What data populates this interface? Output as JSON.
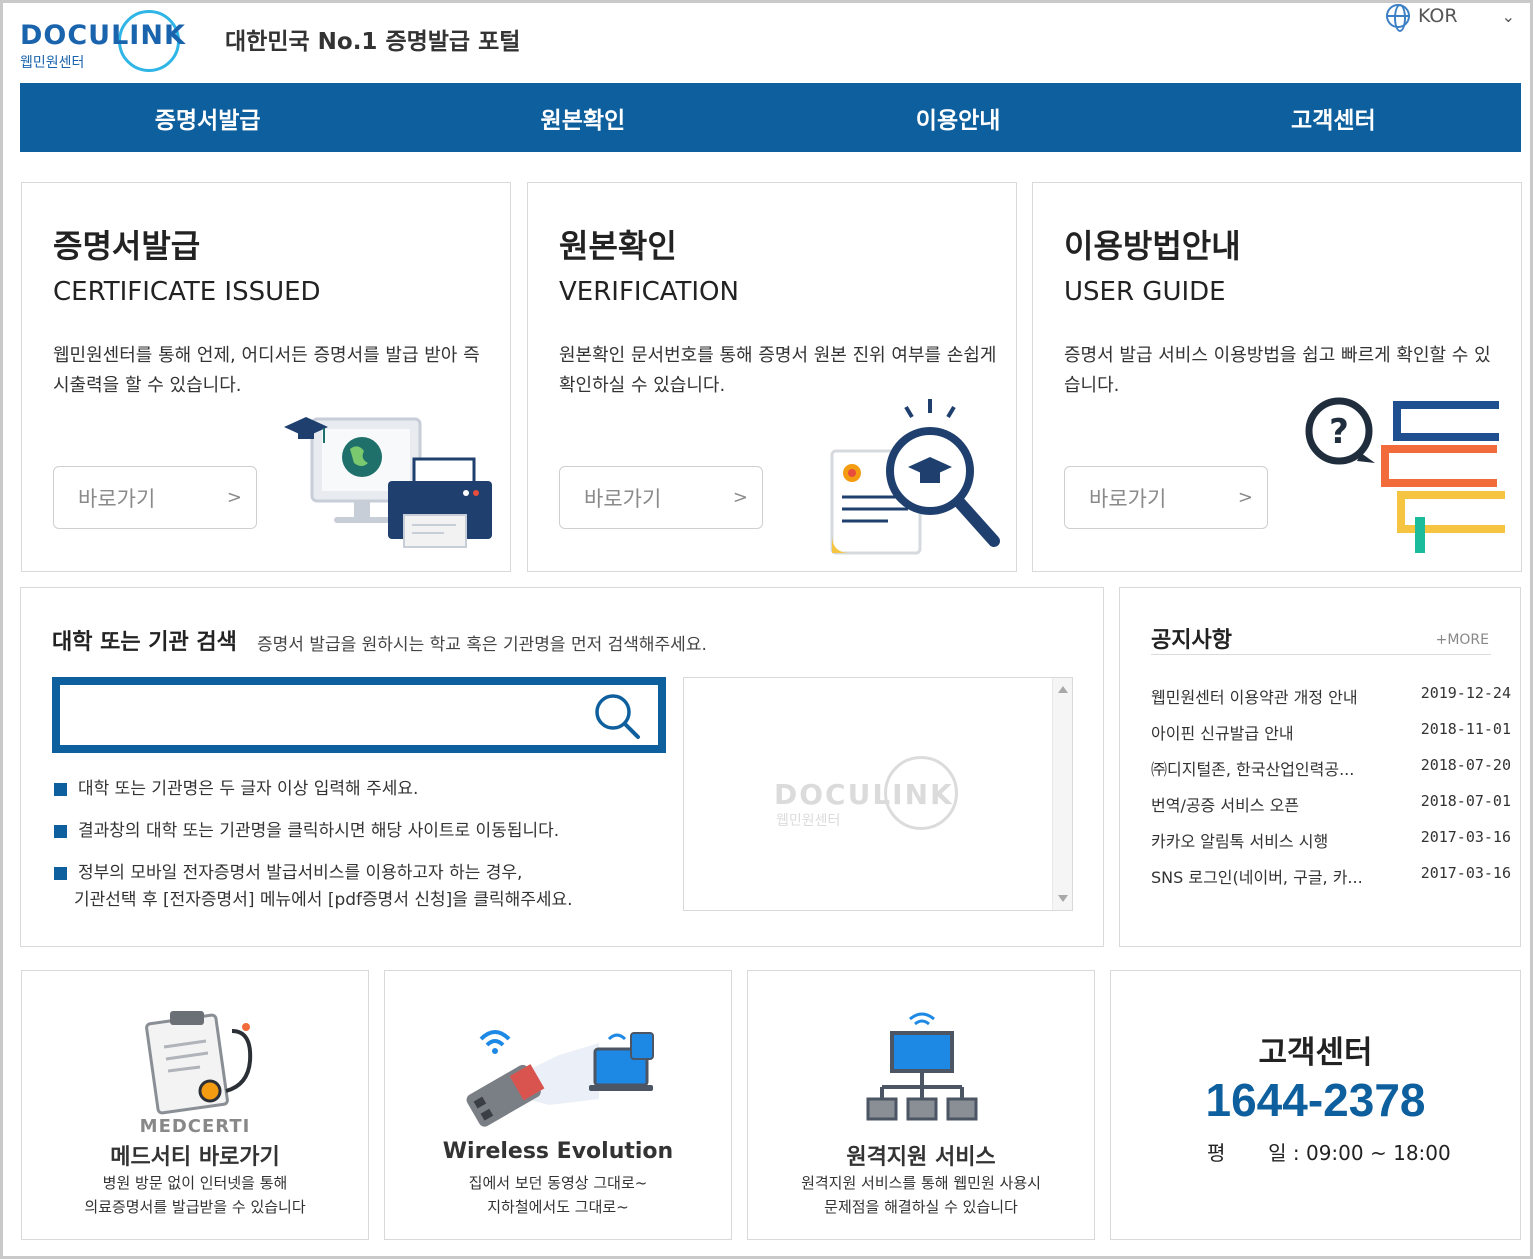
{
  "header": {
    "logo_text": "DOCULINK",
    "logo_sub": "웹민원센터",
    "tagline": "대한민국 No.1 증명발급 포털",
    "language": "KOR"
  },
  "nav": {
    "items": [
      "증명서발급",
      "원본확인",
      "이용안내",
      "고객센터"
    ]
  },
  "cards": [
    {
      "title": "증명서발급",
      "en": "CERTIFICATE ISSUED",
      "desc": "웹민원센터를 통해 언제, 어디서든 증명서를 발급 받아 즉시출력을 할 수 있습니다.",
      "button": "바로가기",
      "arrow": ">"
    },
    {
      "title": "원본확인",
      "en": "VERIFICATION",
      "desc": "원본확인 문서번호를 통해 증명서 원본 진위 여부를 손쉽게 확인하실 수 있습니다.",
      "button": "바로가기",
      "arrow": ">"
    },
    {
      "title": "이용방법안내",
      "en": "USER GUIDE",
      "desc": "증명서 발급 서비스 이용방법을 쉽고 빠르게 확인할 수 있습니다.",
      "button": "바로가기",
      "arrow": ">"
    }
  ],
  "search": {
    "title": "대학 또는 기관 검색",
    "subtitle": "증명서 발급을 원하시는 학교 혹은 기관명을 먼저 검색해주세요.",
    "value": "",
    "bullets": [
      "대학 또는 기관명은 두 글자 이상 입력해 주세요.",
      "결과창의 대학 또는 기관명을 클릭하시면 해당 사이트로 이동됩니다.",
      "정부의 모바일 전자증명서 발급서비스를 이용하고자 하는 경우,",
      "기관선택 후 [전자증명서] 메뉴에서 [pdf증명서 신청]을 클릭해주세요."
    ],
    "watermark_text": "DOCULINK",
    "watermark_sub": "웹민원센터"
  },
  "notice": {
    "title": "공지사항",
    "more": "+MORE",
    "items": [
      {
        "title": "웹민원센터 이용약관 개정 안내",
        "date": "2019-12-24"
      },
      {
        "title": "아이핀 신규발급 안내",
        "date": "2018-11-01"
      },
      {
        "title": "㈜디지털존, 한국산업인력공...",
        "date": "2018-07-20"
      },
      {
        "title": "번역/공증 서비스 오픈",
        "date": "2018-07-01"
      },
      {
        "title": "카카오 알림톡 서비스 시행",
        "date": "2017-03-16"
      },
      {
        "title": "SNS 로그인(네이버, 구글, 카...",
        "date": "2017-03-16"
      }
    ]
  },
  "tiles": [
    {
      "brand": "MEDCERTI",
      "title": "메드서티 바로가기",
      "desc1": "병원 방문 없이 인터넷을 통해",
      "desc2": "의료증명서를 발급받을 수 있습니다"
    },
    {
      "brand": "",
      "title": "Wireless Evolution",
      "desc1": "집에서 보던 동영상 그대로~",
      "desc2": "지하철에서도 그대로~"
    },
    {
      "brand": "",
      "title": "원격지원 서비스",
      "desc1": "원격지원 서비스를 통해 웹민원 사용시",
      "desc2": "문제점을 해결하실 수 있습니다"
    }
  ],
  "customer_center": {
    "title": "고객센터",
    "phone": "1644-2378",
    "hours_label1": "평",
    "hours_label2": "일",
    "hours": ": 09:00 ~ 18:00"
  },
  "colors": {
    "brand_blue": "#0e5f9e",
    "logo_blue": "#1a64ad",
    "ring_cyan": "#2fb5e6"
  }
}
